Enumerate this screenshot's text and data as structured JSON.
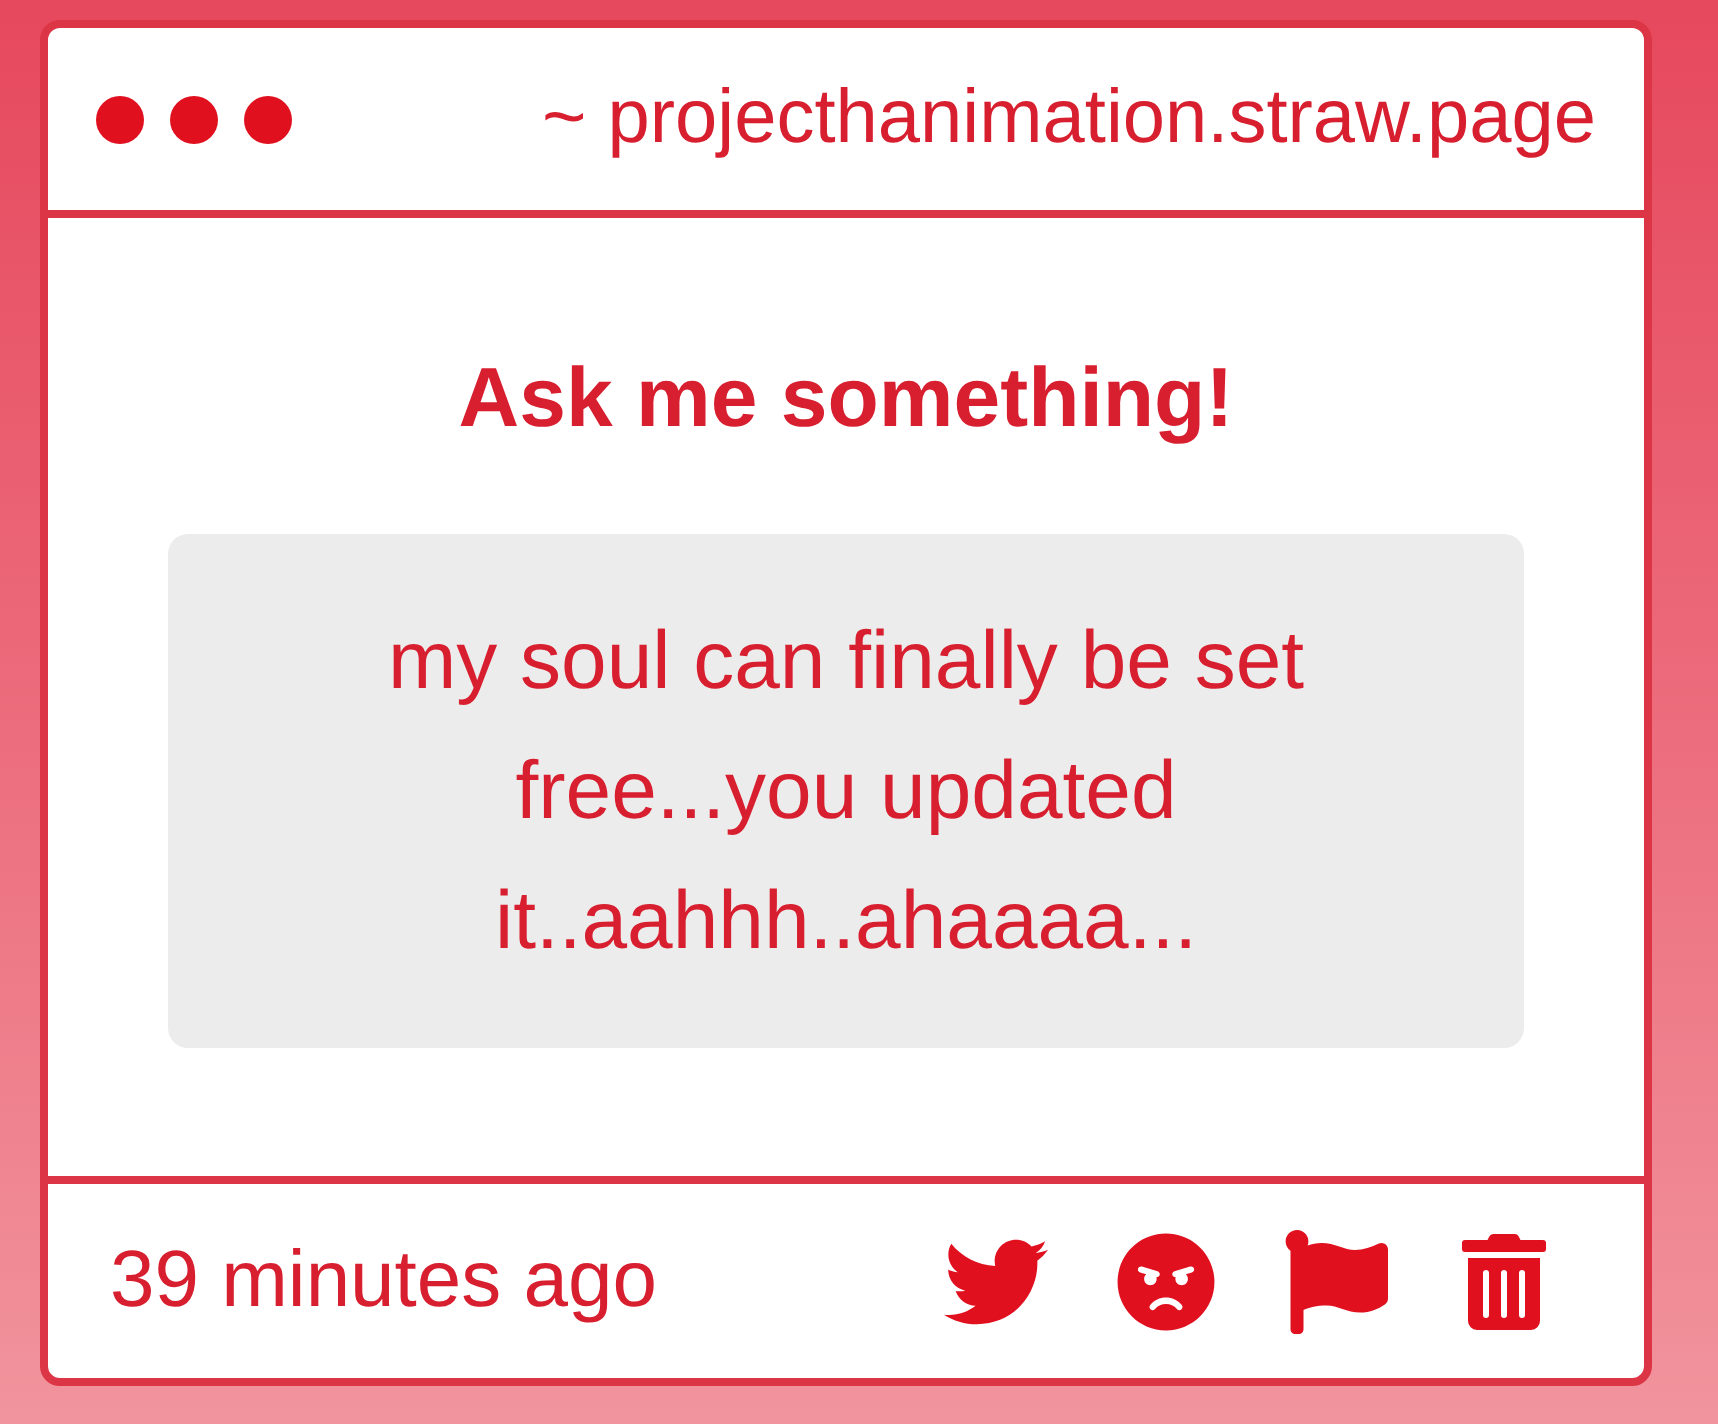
{
  "window": {
    "title": "~ projecthanimation.straw.page"
  },
  "question_card": {
    "heading": "Ask me something!",
    "question": "my soul can finally be set free...you updated it..aahhh..ahaaaa..."
  },
  "footer": {
    "time": "39 minutes ago",
    "actions": [
      {
        "kind": "bird"
      },
      {
        "kind": "angry"
      },
      {
        "kind": "flag"
      },
      {
        "kind": "trash"
      }
    ]
  }
}
